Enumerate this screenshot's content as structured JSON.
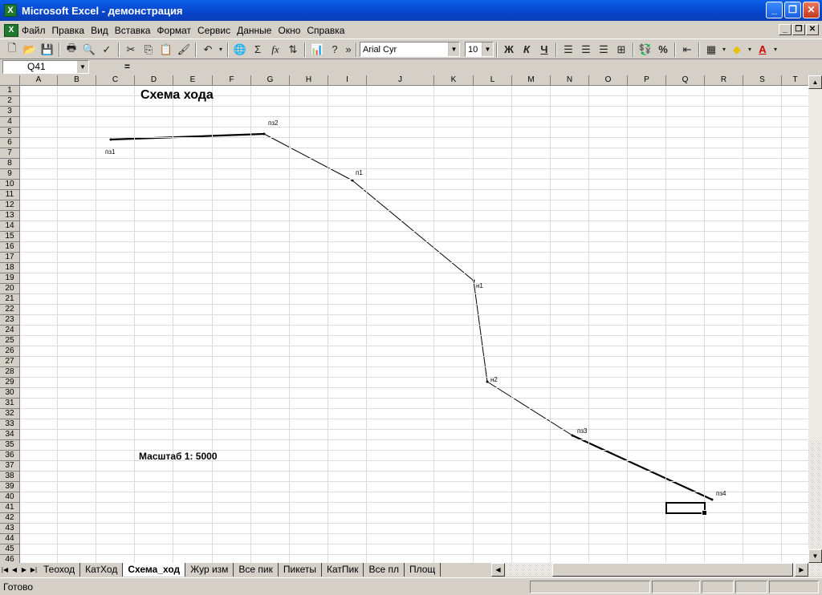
{
  "window": {
    "title": "Microsoft Excel - демонстрация",
    "app_icon": "excel-icon",
    "buttons": {
      "minimize": "_",
      "restore": "❐",
      "close": "✕"
    }
  },
  "menu": {
    "items": [
      "Файл",
      "Правка",
      "Вид",
      "Вставка",
      "Формат",
      "Сервис",
      "Данные",
      "Окно",
      "Справка"
    ]
  },
  "toolbar": {
    "font_name": "Arial Cyr",
    "font_size": "10",
    "bold": "Ж",
    "italic": "К",
    "underline": "Ч",
    "percent": "%",
    "sum": "Σ",
    "fx": "fx",
    "more": "»"
  },
  "formula_bar": {
    "name_box": "Q41",
    "equals": "=",
    "formula": ""
  },
  "grid": {
    "columns": [
      "A",
      "B",
      "C",
      "D",
      "E",
      "F",
      "G",
      "H",
      "I",
      "J",
      "K",
      "L",
      "M",
      "N",
      "O",
      "P",
      "Q",
      "R",
      "S",
      "T"
    ],
    "rows": [
      "1",
      "2",
      "3",
      "4",
      "5",
      "6",
      "7",
      "8",
      "9",
      "10",
      "11",
      "12",
      "13",
      "14",
      "15",
      "16",
      "17",
      "18",
      "19",
      "20",
      "21",
      "22",
      "23",
      "24",
      "25",
      "26",
      "27",
      "28",
      "29",
      "30",
      "31",
      "32",
      "33",
      "34",
      "35",
      "36",
      "37",
      "38",
      "39",
      "40",
      "41",
      "42",
      "43",
      "44",
      "45",
      "46"
    ]
  },
  "sheet": {
    "title": "Схема хода",
    "scale": "Масштаб 1: 5000",
    "points": [
      {
        "label": "пз1"
      },
      {
        "label": "пз2"
      },
      {
        "label": "п1"
      },
      {
        "label": "н1"
      },
      {
        "label": "н2"
      },
      {
        "label": "пз3"
      },
      {
        "label": "пз4"
      }
    ]
  },
  "tabs": {
    "items": [
      "Теоход",
      "КатХод",
      "Схема_ход",
      "Жур изм",
      "Все пик",
      "Пикеты",
      "КатПик",
      "Все пл",
      "Площ"
    ],
    "active": "Схема_ход"
  },
  "status": {
    "text": "Готово"
  }
}
